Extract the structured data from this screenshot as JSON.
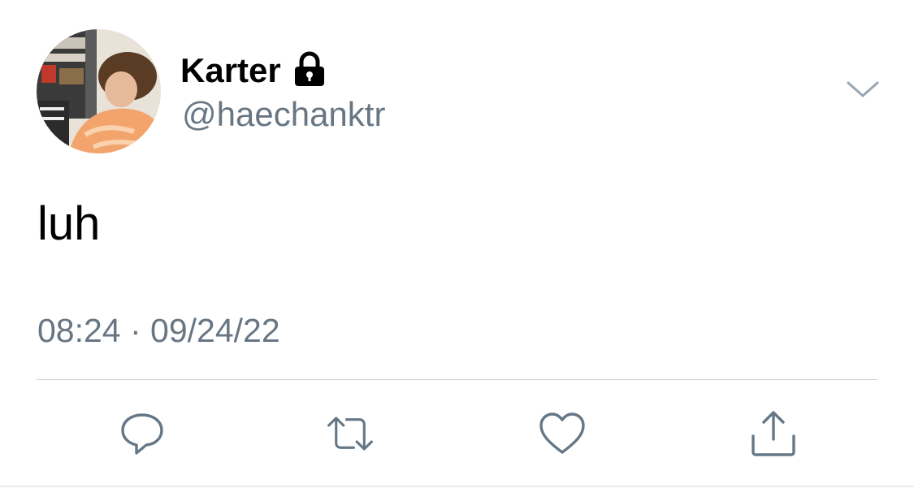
{
  "tweet": {
    "display_name": "Karter",
    "handle": "@haechanktr",
    "text": "luh",
    "timestamp": "08:24 · 09/24/22",
    "protected": true
  },
  "icons": {
    "lock": "lock-icon",
    "more": "chevron-down-icon",
    "reply": "reply-icon",
    "retweet": "retweet-icon",
    "like": "heart-icon",
    "share": "share-icon"
  },
  "colors": {
    "text": "#000000",
    "secondary": "#687684",
    "divider": "#cfd5da"
  }
}
